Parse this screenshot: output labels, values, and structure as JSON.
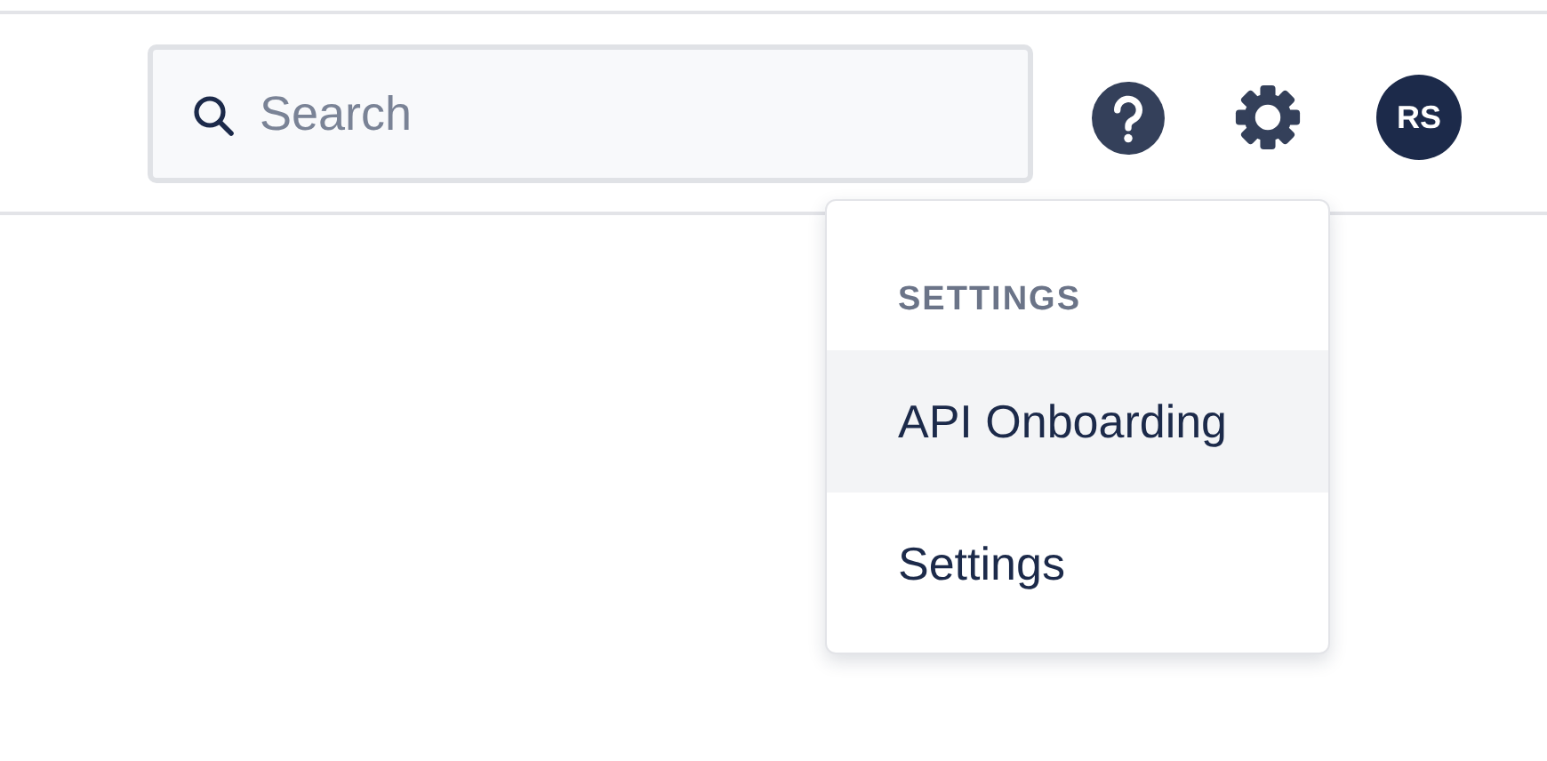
{
  "header": {
    "search": {
      "placeholder": "Search"
    },
    "avatar": {
      "initials": "RS"
    }
  },
  "menu": {
    "heading": "SETTINGS",
    "items": [
      {
        "label": "API Onboarding",
        "highlighted": true
      },
      {
        "label": "Settings",
        "highlighted": false
      }
    ]
  }
}
